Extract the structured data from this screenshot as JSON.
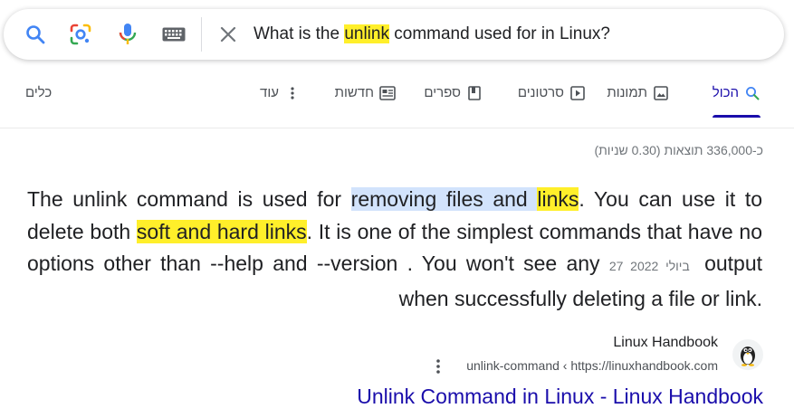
{
  "search": {
    "query_pre": "What is the ",
    "query_highlight": "unlink",
    "query_post": " command used for in Linux?"
  },
  "tabs": {
    "all": "הכול",
    "images": "תמונות",
    "videos": "סרטונים",
    "books": "ספרים",
    "news": "חדשות",
    "more": "עוד",
    "tools": "כלים"
  },
  "stats": "כ-336,000 תוצאות (0.30 שניות)",
  "snippet": {
    "p1": "The unlink command is used for ",
    "sel1": "removing files and ",
    "hl1": "links",
    "p2": ". You can use it to delete both ",
    "hl2": "soft and hard links",
    "p3": ". It is one of the simplest commands that have no options other than --help and --version . You won't see any ",
    "date": "27 ביולי 2022",
    "p4": "output when successfully deleting a file or link."
  },
  "source": {
    "name": "Linux Handbook",
    "url": "unlink-command ‹ https://linuxhandbook.com"
  },
  "result_title": "Unlink Command in Linux - Linux Handbook",
  "colors": {
    "link": "#1a0dab",
    "highlight": "#ffef2a",
    "selection": "#d2e3fc"
  }
}
